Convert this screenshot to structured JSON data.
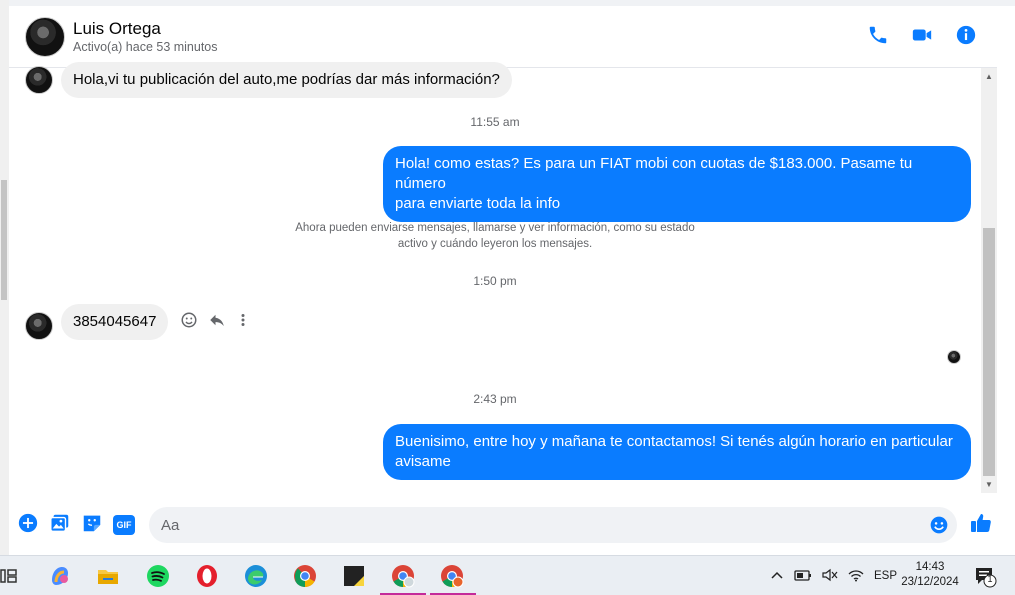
{
  "header": {
    "name": "Luis Ortega",
    "status": "Activo(a) hace 53 minutos"
  },
  "messages": {
    "m1": "Hola,vi tu publicación del auto,me podrías dar más información?",
    "ts1": "11:55 am",
    "m2_line1": "Hola! como estas? Es para un FIAT mobi con cuotas de $183.000. Pasame tu número",
    "m2_line2": "para enviarte toda la info",
    "sys_line1": "Ahora pueden enviarse mensajes, llamarse y ver información, como su estado",
    "sys_line2": "activo y cuándo leyeron los mensajes.",
    "ts2": "1:50 pm",
    "m3": "3854045647",
    "ts3": "2:43 pm",
    "m4_line1": "Buenisimo, entre hoy y mañana te contactamos! Si tenés algún horario en particular",
    "m4_line2": "avisame"
  },
  "composer": {
    "placeholder": "Aa",
    "gif_label": "GIF"
  },
  "taskbar": {
    "lang": "ESP",
    "time": "14:43",
    "date": "23/12/2024",
    "notif_count": "1"
  },
  "colors": {
    "accent": "#0a7cff",
    "bubble_in": "#f0f0f0"
  }
}
